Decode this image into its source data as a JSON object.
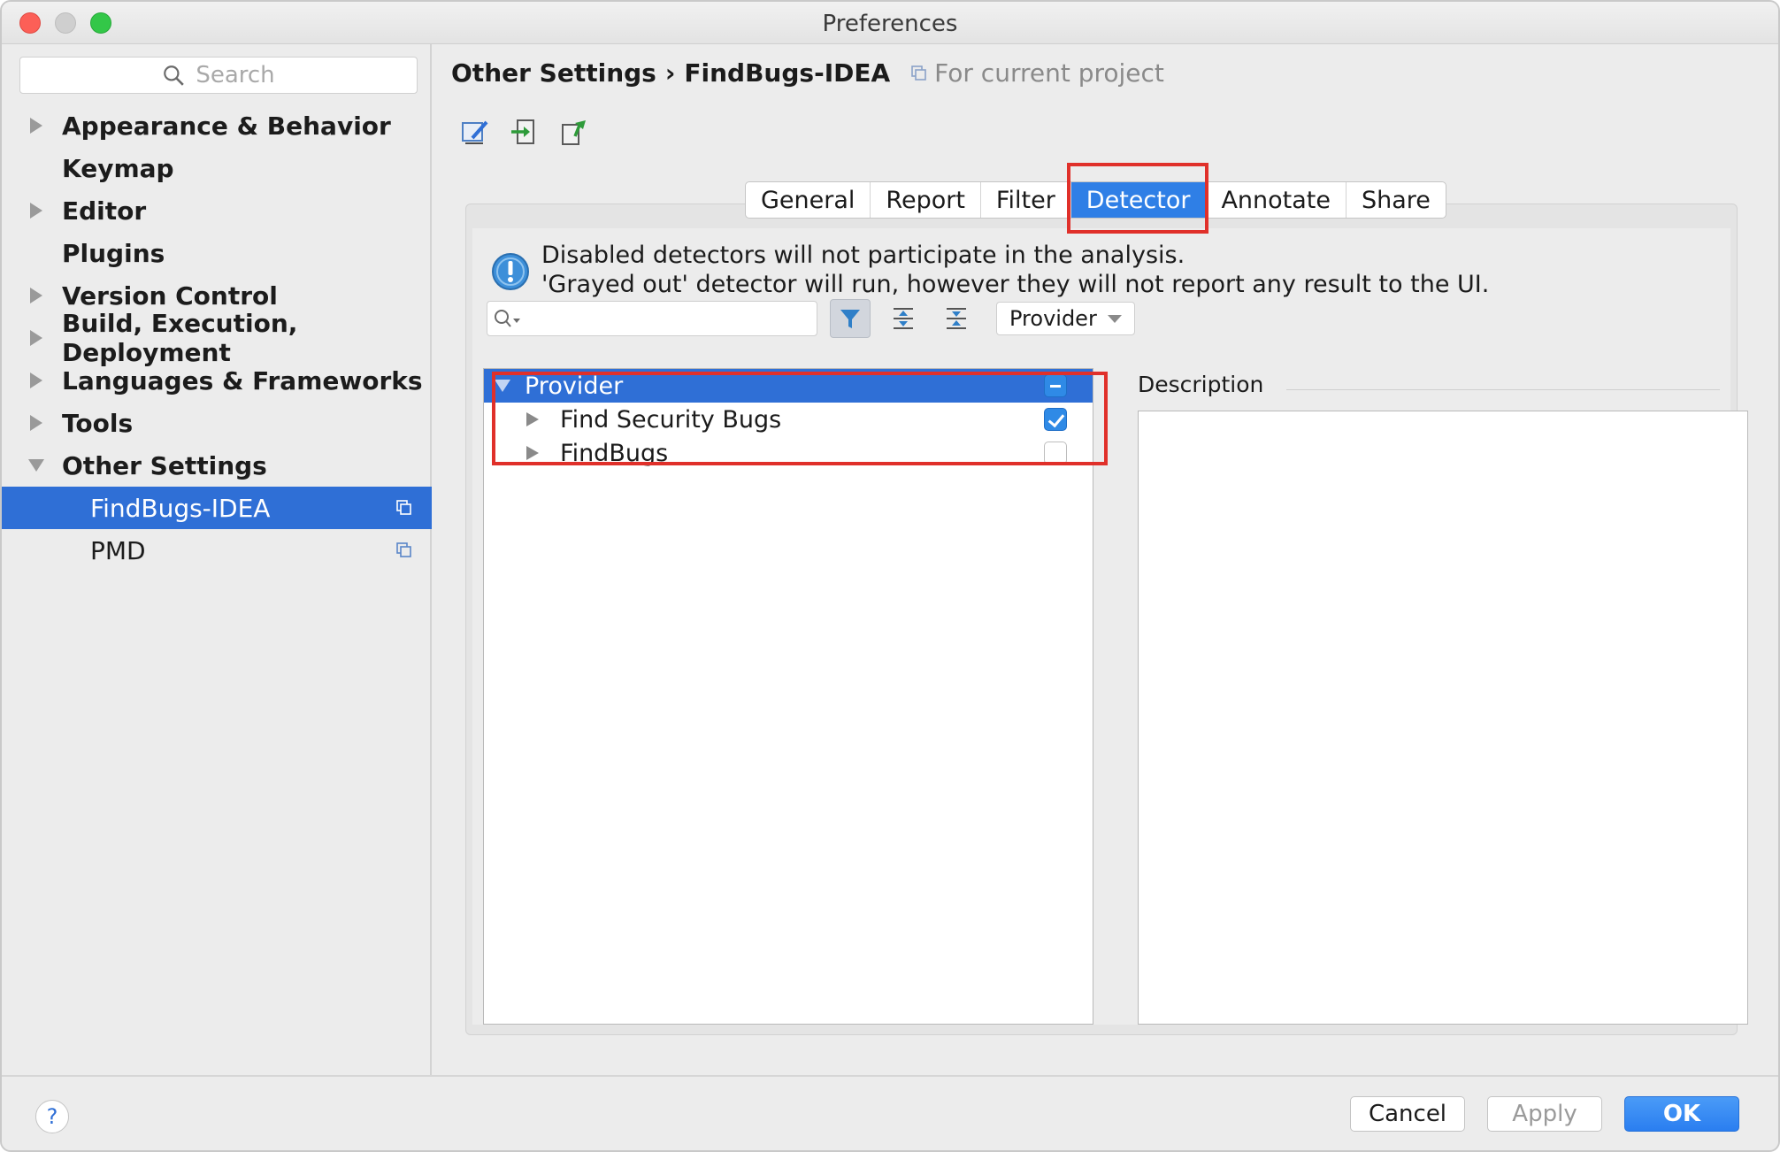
{
  "window": {
    "title": "Preferences"
  },
  "sidebar": {
    "search_placeholder": "Search",
    "items": [
      {
        "label": "Appearance & Behavior",
        "expandable": true
      },
      {
        "label": "Keymap",
        "expandable": false
      },
      {
        "label": "Editor",
        "expandable": true
      },
      {
        "label": "Plugins",
        "expandable": false
      },
      {
        "label": "Version Control",
        "expandable": true
      },
      {
        "label": "Build, Execution, Deployment",
        "expandable": true
      },
      {
        "label": "Languages & Frameworks",
        "expandable": true
      },
      {
        "label": "Tools",
        "expandable": true
      },
      {
        "label": "Other Settings",
        "expandable": true,
        "expanded": true
      },
      {
        "label": "FindBugs-IDEA",
        "selected": true,
        "project_icon": "copy-icon"
      },
      {
        "label": "PMD",
        "project_icon": "copy-icon"
      }
    ]
  },
  "header": {
    "breadcrumb_parent": "Other Settings",
    "breadcrumb_separator": "›",
    "breadcrumb_current": "FindBugs-IDEA",
    "scope": "For current project"
  },
  "tabs": [
    {
      "label": "General"
    },
    {
      "label": "Report"
    },
    {
      "label": "Filter"
    },
    {
      "label": "Detector",
      "active": true
    },
    {
      "label": "Annotate"
    },
    {
      "label": "Share"
    }
  ],
  "detector": {
    "info_line1": "Disabled detectors will not participate in the analysis.",
    "info_line2": "'Grayed out' detector will run, however they will not report any result to the UI.",
    "group_by": "Provider",
    "tree": {
      "root": {
        "label": "Provider",
        "state": "partial"
      },
      "children": [
        {
          "label": "Find Security Bugs",
          "checked": true
        },
        {
          "label": "FindBugs",
          "checked": false
        }
      ]
    },
    "description_label": "Description"
  },
  "footer": {
    "help": "?",
    "cancel": "Cancel",
    "apply": "Apply",
    "ok": "OK"
  },
  "colors": {
    "selection": "#2f6fd6",
    "active_tab": "#2f7fe6",
    "highlight_box": "#e0302a",
    "ok_button": "#2a7ef0"
  }
}
